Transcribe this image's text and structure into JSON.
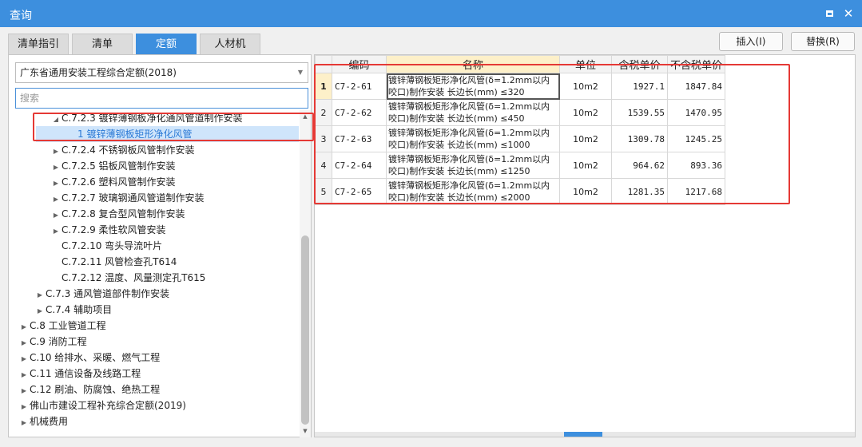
{
  "window": {
    "title": "查询"
  },
  "tabs": [
    {
      "label": "清单指引",
      "active": false
    },
    {
      "label": "清单",
      "active": false
    },
    {
      "label": "定额",
      "active": true
    },
    {
      "label": "人材机",
      "active": false
    }
  ],
  "buttons": {
    "insert": "插入(I)",
    "replace": "替换(R)"
  },
  "left": {
    "library": "广东省通用安装工程综合定额(2018)",
    "search_placeholder": "搜索",
    "tree": [
      {
        "label": "C.7.2.3 镀锌薄钢板净化通风管道制作安装",
        "level": 3,
        "arrow": "expanded"
      },
      {
        "label": "1 镀锌薄钢板矩形净化风管",
        "level": 4,
        "arrow": "none",
        "selected": true
      },
      {
        "label": "C.7.2.4 不锈钢板风管制作安装",
        "level": 3,
        "arrow": "collapsed"
      },
      {
        "label": "C.7.2.5 铝板风管制作安装",
        "level": 3,
        "arrow": "collapsed"
      },
      {
        "label": "C.7.2.6 塑料风管制作安装",
        "level": 3,
        "arrow": "collapsed"
      },
      {
        "label": "C.7.2.7 玻璃钢通风管道制作安装",
        "level": 3,
        "arrow": "collapsed"
      },
      {
        "label": "C.7.2.8 复合型风管制作安装",
        "level": 3,
        "arrow": "collapsed"
      },
      {
        "label": "C.7.2.9 柔性软风管安装",
        "level": 3,
        "arrow": "collapsed"
      },
      {
        "label": "C.7.2.10 弯头导流叶片",
        "level": 3,
        "arrow": "none"
      },
      {
        "label": "C.7.2.11 风管检查孔T614",
        "level": 3,
        "arrow": "none"
      },
      {
        "label": "C.7.2.12 温度、风量测定孔T615",
        "level": 3,
        "arrow": "none"
      },
      {
        "label": "C.7.3 通风管道部件制作安装",
        "level": 2,
        "arrow": "collapsed"
      },
      {
        "label": "C.7.4 辅助项目",
        "level": 2,
        "arrow": "collapsed"
      },
      {
        "label": "C.8 工业管道工程",
        "level": 1,
        "arrow": "collapsed"
      },
      {
        "label": "C.9 消防工程",
        "level": 1,
        "arrow": "collapsed"
      },
      {
        "label": "C.10 给排水、采暖、燃气工程",
        "level": 1,
        "arrow": "collapsed"
      },
      {
        "label": "C.11 通信设备及线路工程",
        "level": 1,
        "arrow": "collapsed"
      },
      {
        "label": "C.12 刷油、防腐蚀、绝热工程",
        "level": 1,
        "arrow": "collapsed"
      },
      {
        "label": "佛山市建设工程补充综合定额(2019)",
        "level": 1,
        "arrow": "collapsed"
      },
      {
        "label": "机械费用",
        "level": 1,
        "arrow": "collapsed"
      }
    ]
  },
  "grid": {
    "headers": {
      "code": "编码",
      "name": "名称",
      "unit": "单位",
      "price_tax": "含税单价",
      "price_notax": "不含税单价"
    },
    "rows": [
      {
        "n": "1",
        "code": "C7-2-61",
        "name": "镀锌薄钢板矩形净化风管(δ=1.2mm以内咬口)制作安装 长边长(mm) ≤320",
        "unit": "10m2",
        "price_tax": "1927.1",
        "price_notax": "1847.84",
        "current": true
      },
      {
        "n": "2",
        "code": "C7-2-62",
        "name": "镀锌薄钢板矩形净化风管(δ=1.2mm以内咬口)制作安装 长边长(mm) ≤450",
        "unit": "10m2",
        "price_tax": "1539.55",
        "price_notax": "1470.95"
      },
      {
        "n": "3",
        "code": "C7-2-63",
        "name": "镀锌薄钢板矩形净化风管(δ=1.2mm以内咬口)制作安装 长边长(mm) ≤1000",
        "unit": "10m2",
        "price_tax": "1309.78",
        "price_notax": "1245.25"
      },
      {
        "n": "4",
        "code": "C7-2-64",
        "name": "镀锌薄钢板矩形净化风管(δ=1.2mm以内咬口)制作安装 长边长(mm) ≤1250",
        "unit": "10m2",
        "price_tax": "964.62",
        "price_notax": "893.36"
      },
      {
        "n": "5",
        "code": "C7-2-65",
        "name": "镀锌薄钢板矩形净化风管(δ=1.2mm以内咬口)制作安装 长边长(mm) ≤2000",
        "unit": "10m2",
        "price_tax": "1281.35",
        "price_notax": "1217.68"
      }
    ]
  },
  "colors": {
    "accent": "#3d8fde",
    "highlight_header": "#fdf0c9",
    "annotation_red": "#e53935"
  }
}
